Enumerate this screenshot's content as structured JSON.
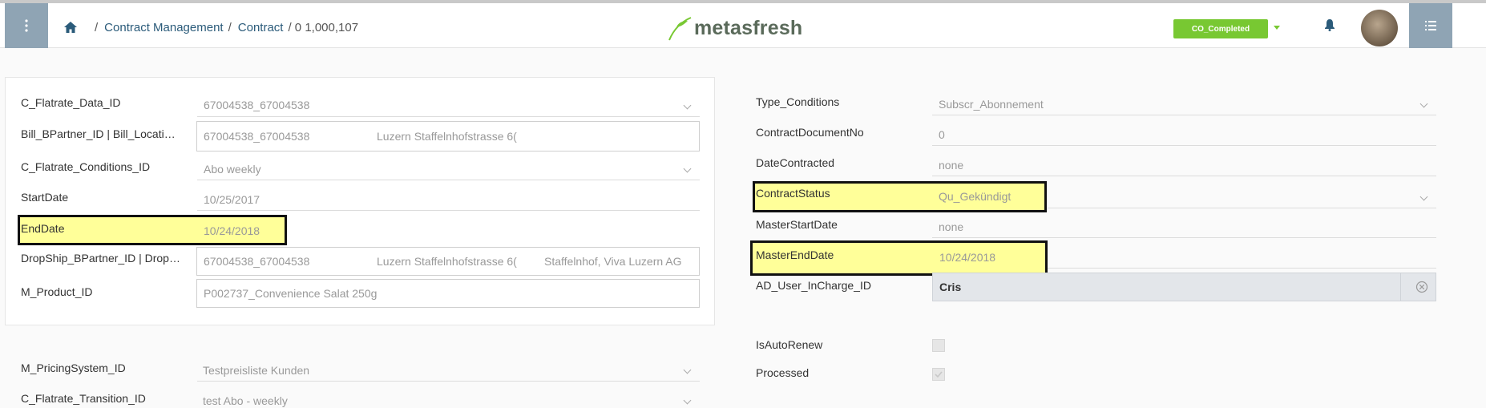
{
  "header": {
    "breadcrumb": {
      "sep": "/",
      "items": [
        "Contract Management",
        "Contract"
      ],
      "current": "/ 0 1,000,107"
    },
    "logo_text": "metasfresh",
    "doc_status": "CO_Completed",
    "accent": "#78c832",
    "menu_icon": "more-vert-icon",
    "list_icon": "list-icon"
  },
  "left": {
    "flatrate_data": {
      "label": "C_Flatrate_Data_ID",
      "value": "67004538_67004538"
    },
    "bill_bpartner": {
      "label": "Bill_BPartner_ID | Bill_Locati…",
      "value1": "67004538_67004538",
      "value2": "Luzern Staffelnhofstrasse 6("
    },
    "conditions": {
      "label": "C_Flatrate_Conditions_ID",
      "value": "Abo weekly"
    },
    "start_date": {
      "label": "StartDate",
      "value": "10/25/2017"
    },
    "end_date": {
      "label": "EndDate",
      "value": "10/24/2018"
    },
    "dropship": {
      "label": "DropShip_BPartner_ID | Drop…",
      "value1": "67004538_67004538",
      "value2": "Luzern Staffelnhofstrasse 6(",
      "value3": "Staffelnhof, Viva Luzern AG"
    },
    "product": {
      "label": "M_Product_ID",
      "value": "P002737_Convenience Salat 250g"
    },
    "pricing_system": {
      "label": "M_PricingSystem_ID",
      "value": "Testpreisliste Kunden"
    },
    "transition": {
      "label": "C_Flatrate_Transition_ID",
      "value": "test Abo - weekly"
    }
  },
  "right": {
    "type_conditions": {
      "label": "Type_Conditions",
      "value": "Subscr_Abonnement"
    },
    "contract_doc_no": {
      "label": "ContractDocumentNo",
      "value": "0"
    },
    "date_contracted": {
      "label": "DateContracted",
      "value": "none"
    },
    "contract_status": {
      "label": "ContractStatus",
      "value": "Qu_Gekündigt"
    },
    "master_start": {
      "label": "MasterStartDate",
      "value": "none"
    },
    "master_end": {
      "label": "MasterEndDate",
      "value": "10/24/2018"
    },
    "user_in_charge": {
      "label": "AD_User_InCharge_ID",
      "value": "Cris"
    },
    "is_auto_renew": {
      "label": "IsAutoRenew",
      "checked": false
    },
    "processed": {
      "label": "Processed",
      "checked": true
    }
  }
}
